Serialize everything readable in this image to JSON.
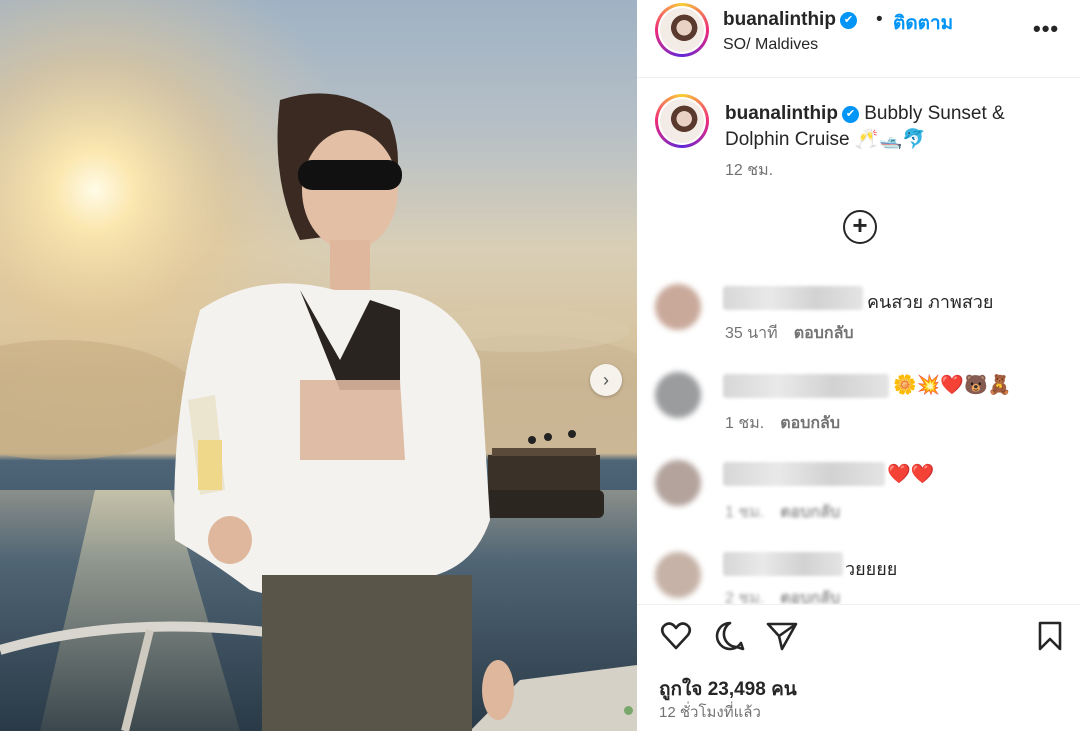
{
  "post": {
    "username": "buanalinthip",
    "verified_mark": "✔",
    "bullet": "•",
    "follow_label": "ติดตาม",
    "location": "SO/ Maldives",
    "more_label": "•••"
  },
  "caption": {
    "username": "buanalinthip",
    "text": "Bubbly Sunset & Dolphin Cruise 🥂🛥️🐬",
    "time": "12 ชม.",
    "add_label": "+"
  },
  "comments": [
    {
      "text": "คนสวย ภาพสวย",
      "time": "35 นาที",
      "reply": "ตอบกลับ"
    },
    {
      "text": "🌼💥❤️🐻🧸",
      "time": "1 ชม.",
      "reply": "ตอบกลับ"
    },
    {
      "text": "❤️❤️",
      "time": "1 ชม.",
      "reply": "ตอบกลับ"
    },
    {
      "text": "วยยยย",
      "time": "2 ชม.",
      "reply": "ตอบกลับ"
    }
  ],
  "actions": {
    "like_icon": "heart-icon",
    "comment_icon": "comment-icon",
    "share_icon": "share-icon",
    "save_icon": "bookmark-icon"
  },
  "likes_text": "ถูกใจ 23,498 คน",
  "posted_ago": "12 ชั่วโมงที่แล้ว",
  "carousel_next": "›",
  "colors": {
    "link_blue": "#0095f6",
    "muted": "#737373",
    "text": "#262626"
  }
}
